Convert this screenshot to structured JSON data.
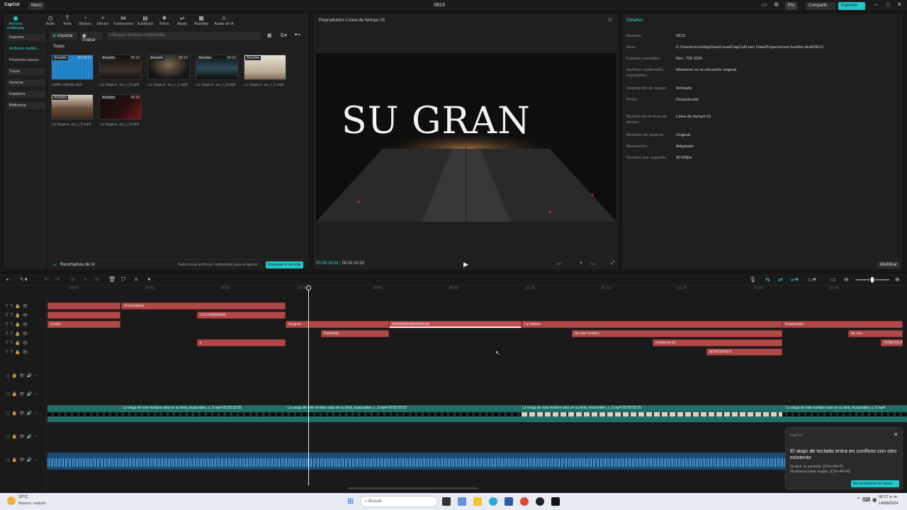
{
  "app": {
    "logo": "CapCut",
    "menu": "Menú",
    "title": "0813",
    "pro": "Pro",
    "share": "Compartir",
    "export": "Exportar"
  },
  "toptabs": [
    {
      "label": "Archivos multimedia",
      "icon": "media-icon"
    },
    {
      "label": "Audio",
      "icon": "audio-icon"
    },
    {
      "label": "Texto",
      "icon": "text-icon"
    },
    {
      "label": "Stickers",
      "icon": "sticker-icon"
    },
    {
      "label": "Efectos",
      "icon": "effects-icon"
    },
    {
      "label": "Transiciones",
      "icon": "transitions-icon"
    },
    {
      "label": "Subtítulos",
      "icon": "subtitles-icon"
    },
    {
      "label": "Filtros",
      "icon": "filters-icon"
    },
    {
      "label": "Ajuste",
      "icon": "adjust-icon"
    },
    {
      "label": "Plantillas",
      "icon": "templates-icon"
    },
    {
      "label": "Avatar de IA",
      "icon": "avatar-icon"
    }
  ],
  "sidebar": {
    "items": [
      "Importar",
      "Archivos multim...",
      "Proyectos secun...",
      "Tuyos",
      "Generar",
      "Espacios",
      "Biblioteca"
    ]
  },
  "media": {
    "import": "Importar",
    "record": "Grabar",
    "search_placeholder": "Buscar archivos multimedia",
    "section": "Todos",
    "items": [
      {
        "badge": "Añadido",
        "dur": "00:03:12",
        "name": "Limite Latente.mp3"
      },
      {
        "badge": "Añadido",
        "dur": "00:10",
        "name": "La verga d...ao_v_5.mp4"
      },
      {
        "badge": "Añadido",
        "dur": "00:10",
        "name": "La verga d...ao_v_1.mp4"
      },
      {
        "badge": "Añadido",
        "dur": "00:10",
        "name": "La verga d...ao_v_3.mp4"
      },
      {
        "badge": "Añadido",
        "dur": "",
        "name": "La verga d...ao_v_5.mp4"
      },
      {
        "badge": "Añadido",
        "dur": "",
        "name": "La verga d...ao_v_6.mp4"
      },
      {
        "badge": "Añadido",
        "dur": "00:10",
        "name": "La verga d...ao_v_6.mp4"
      }
    ],
    "ai_cutter": "Recortadora de IA",
    "ai_hint": "Selecciona archivos multimedia para empezar",
    "ai_button": "Empezar a recortar"
  },
  "player": {
    "title": "Reproductor-Línea de tiempo 01",
    "overlay": "SU GRAN",
    "current": "00:00:29:04",
    "total": "00:01:10:02"
  },
  "details": {
    "title": "Detalles",
    "modify": "Modificar",
    "rows": [
      {
        "label": "Nombre:",
        "value": "0813"
      },
      {
        "label": "Ruta:",
        "value": "C:/Users/circe/AppData/Local/CapCut/User Data/Projects/com.lveditor.draft/0813"
      },
      {
        "label": "Espacio cromático:",
        "value": "Rec. 709 SDR"
      },
      {
        "label": "Archivos multimedia importados:",
        "value": "Mantener en la ubicación original"
      },
      {
        "label": "Disposición de capas:",
        "value": "Activado"
      },
      {
        "label": "Proxy:",
        "value": "Desactivado"
      },
      {
        "label": "Nombre de la línea de tiempo:",
        "value": "Línea de tiempo 01"
      },
      {
        "label": "Relación de aspecto:",
        "value": "Original"
      },
      {
        "label": "Resolución:",
        "value": "Adaptado"
      },
      {
        "label": "Cuadros por segundo:",
        "value": "30.00fps"
      }
    ]
  },
  "ruler": [
    "00:00",
    "00:10",
    "00:20",
    "00:30",
    "00:40",
    "00:50",
    "01:00",
    "01:10",
    "01:20",
    "01:30",
    "01:40"
  ],
  "clips": [
    {
      "text": "Venezolanas",
      "track": 0
    },
    {
      "text": "",
      "track": 0
    },
    {
      "text": "",
      "track": 1
    },
    {
      "text": "COLOMBIANAS",
      "track": 1
    },
    {
      "text": "el país",
      "track": 2
    },
    {
      "text": "Su gran",
      "track": 2
    },
    {
      "text": "AAAAAAAAAAAAAAAA",
      "track": 2
    },
    {
      "text": "La historia",
      "track": 2
    },
    {
      "text": "Enamorado",
      "track": 2
    },
    {
      "text": "Debilidad",
      "track": 3
    },
    {
      "text": "de este hombre",
      "track": 3
    },
    {
      "text": "de una",
      "track": 3
    },
    {
      "text": "y",
      "track": 4
    },
    {
      "text": "comienza en",
      "track": 4
    },
    {
      "text": "VENEZOLA",
      "track": 4
    },
    {
      "text": "MONTERREY",
      "track": 5
    }
  ],
  "video_clips": [
    {
      "label": "La verga de este hombre esta en su limit_musicvideo_v_5.mp4   00:00:03:05"
    },
    {
      "label": "La verga de este hombre esta en su limit_musicvideo_v_3.mp4   00:00:03:03"
    },
    {
      "label": "La verga de este hombre esta en su limit_musicvideo_v_5.mp4   00:00:03:15"
    },
    {
      "label": "La verga de este hombre esta en su limit_musicvideo_v_6.mp4"
    }
  ],
  "toast": {
    "app": "CapCut",
    "title": "El atajo de teclado entra en conflicto con otro existente",
    "line1": "Grabar la pantalla: [Ctrl+Alt+P]",
    "line2": "Mostrar/ocultar reglas: [Ctrl+Alt+R]",
    "button": "No recordarme de nuevo"
  },
  "taskbar": {
    "weather_temp": "20°C",
    "weather_desc": "Mayorm. nublado",
    "search": "Buscar",
    "time": "06:27 a. m.",
    "date": "14/08/2024"
  }
}
